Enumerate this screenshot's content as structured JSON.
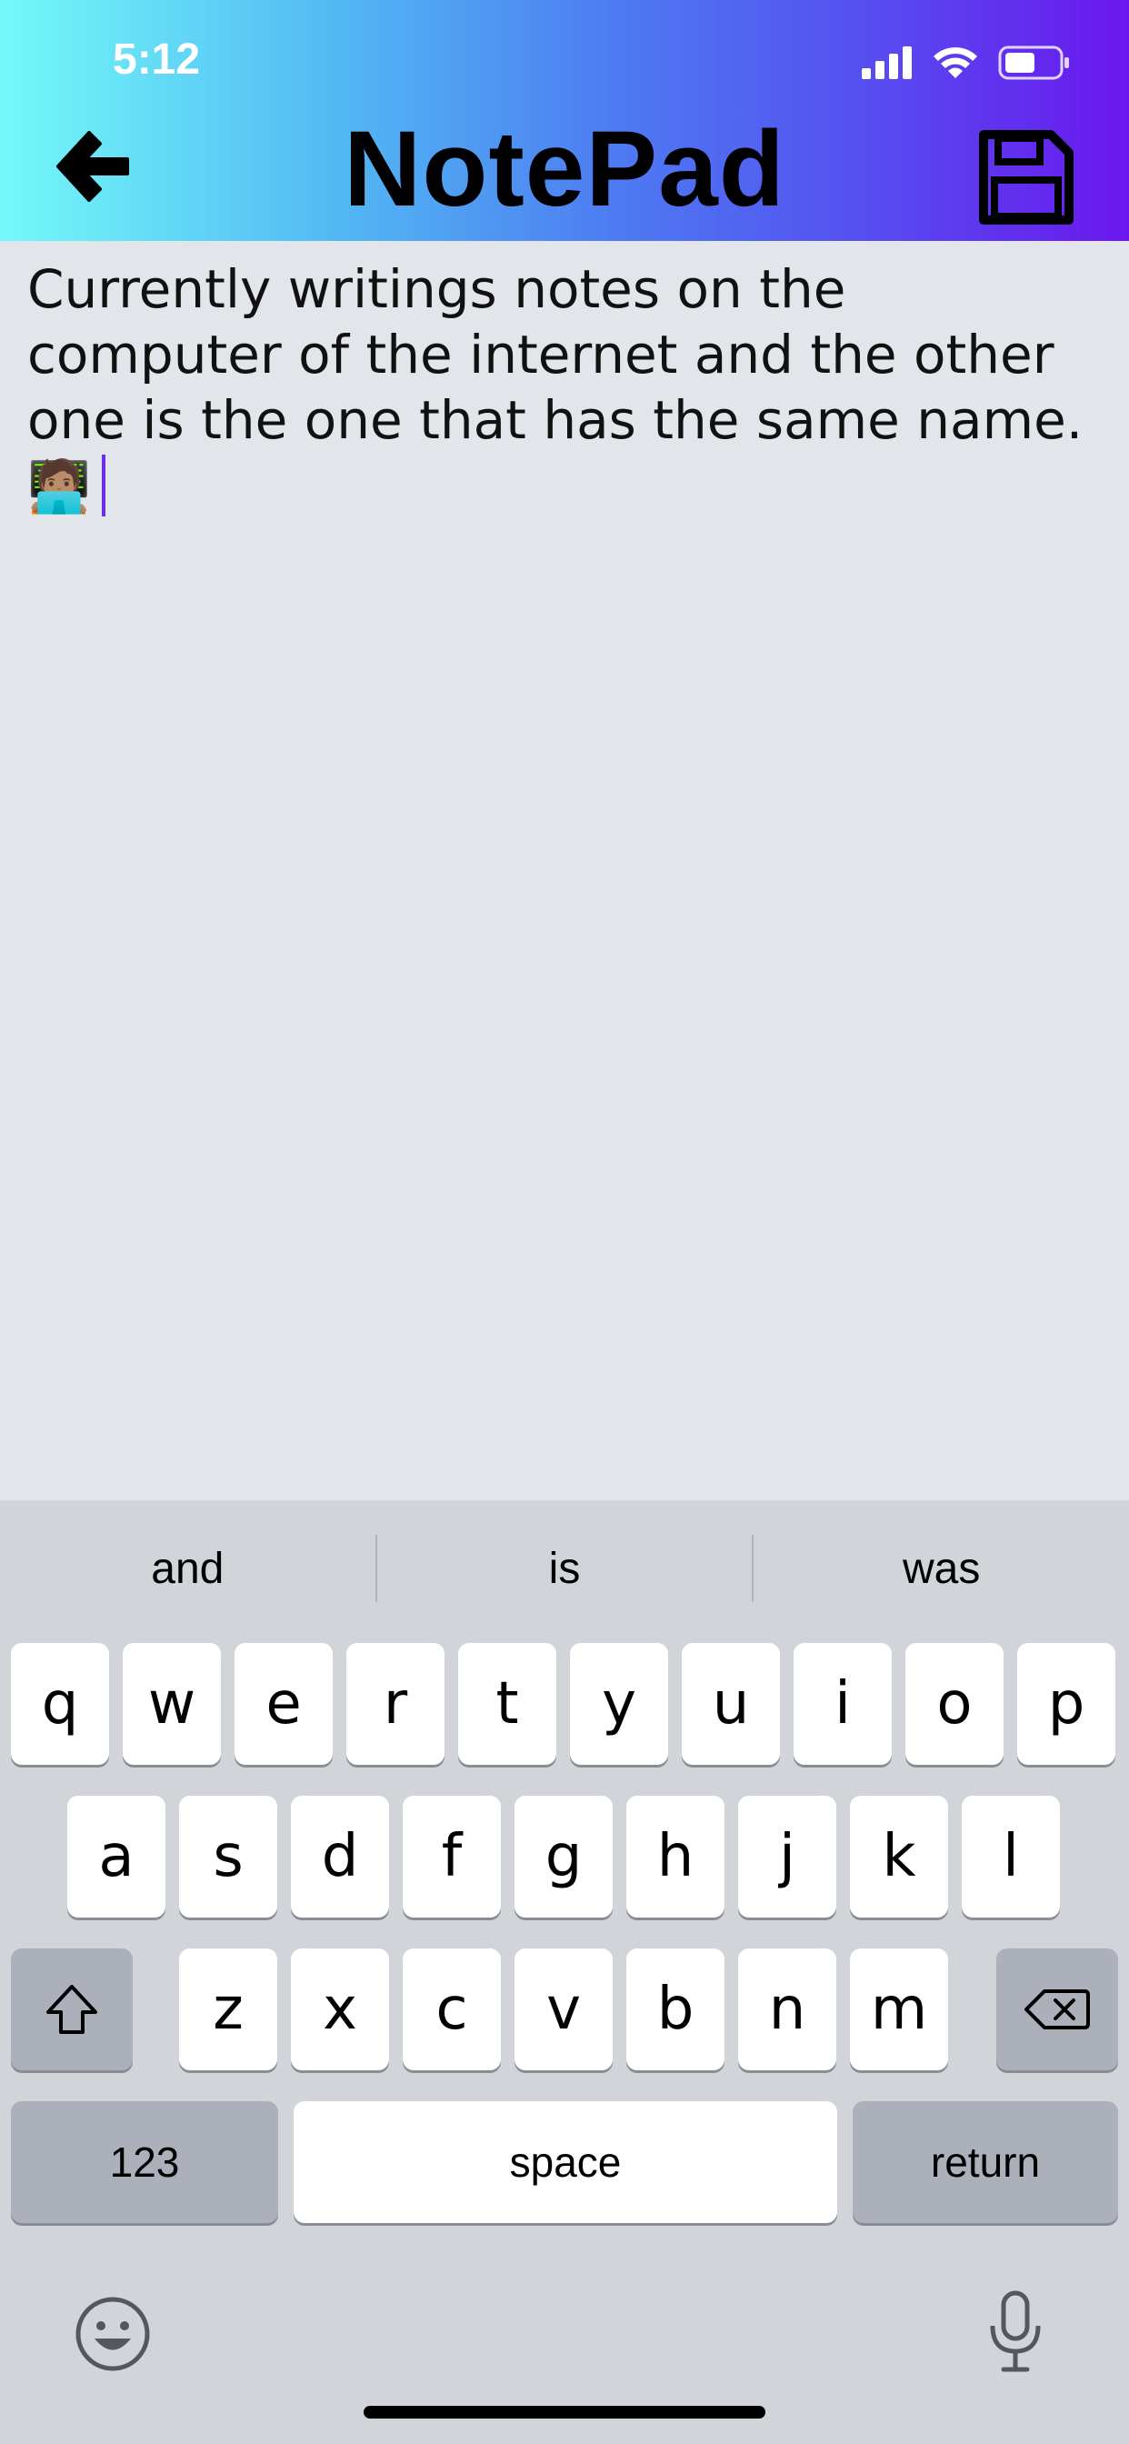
{
  "status_bar": {
    "time": "5:12"
  },
  "header": {
    "title": "NotePad"
  },
  "note": {
    "text": "Currently writings notes on the computer of the internet and the other one is the one that has the same name.",
    "emoji": "🧑🏽‍💻"
  },
  "keyboard": {
    "suggestions": [
      "and",
      "is",
      "was"
    ],
    "row1": [
      "q",
      "w",
      "e",
      "r",
      "t",
      "y",
      "u",
      "i",
      "o",
      "p"
    ],
    "row2": [
      "a",
      "s",
      "d",
      "f",
      "g",
      "h",
      "j",
      "k",
      "l"
    ],
    "row3": [
      "z",
      "x",
      "c",
      "v",
      "b",
      "n",
      "m"
    ],
    "numbers_label": "123",
    "space_label": "space",
    "return_label": "return"
  },
  "colors": {
    "cursor": "#6b2fe8",
    "gradient_start": "#74f9f9",
    "gradient_end": "#6a17ee"
  }
}
